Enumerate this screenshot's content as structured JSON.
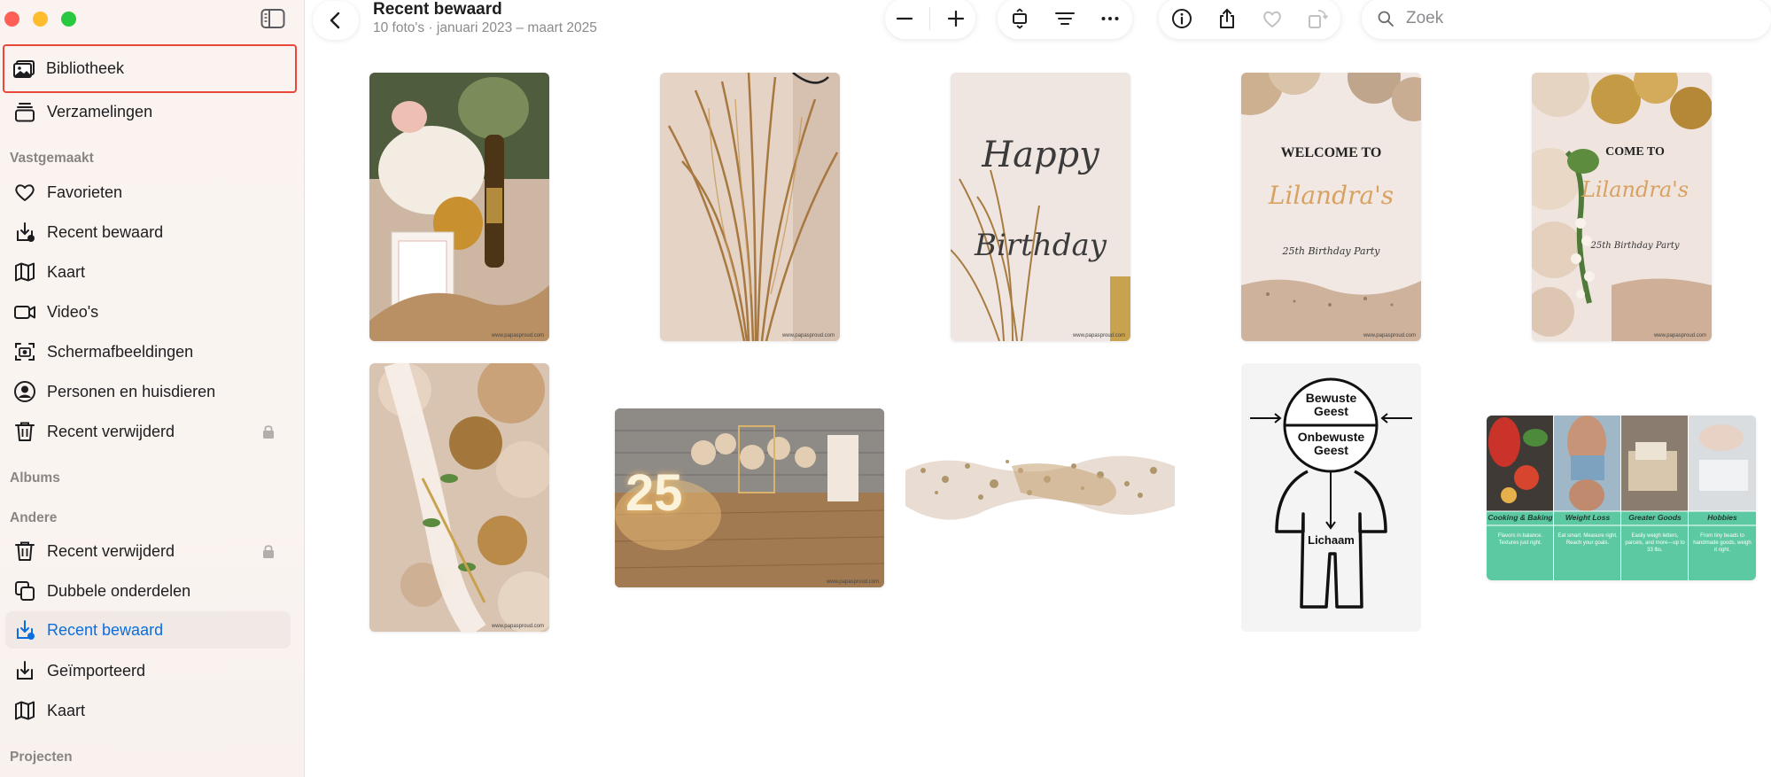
{
  "window": {
    "title": "Recent bewaard",
    "subtitle": "10 foto's · januari 2023 – maart 2025"
  },
  "sidebar": {
    "top_items": [
      {
        "label": "Bibliotheek",
        "icon": "photo-library-icon"
      },
      {
        "label": "Verzamelingen",
        "icon": "collections-icon"
      }
    ],
    "sections": {
      "pinned": "Vastgemaakt",
      "albums": "Albums",
      "other": "Andere",
      "projects": "Projecten"
    },
    "pinned_items": [
      {
        "label": "Favorieten",
        "icon": "heart-icon"
      },
      {
        "label": "Recent bewaard",
        "icon": "recently-saved-icon"
      },
      {
        "label": "Kaart",
        "icon": "map-icon"
      },
      {
        "label": "Video's",
        "icon": "video-icon"
      },
      {
        "label": "Schermafbeeldingen",
        "icon": "screenshot-icon"
      },
      {
        "label": "Personen en huisdieren",
        "icon": "person-icon"
      },
      {
        "label": "Recent verwijderd",
        "icon": "trash-icon",
        "locked": true
      }
    ],
    "other_items": [
      {
        "label": "Recent verwijderd",
        "icon": "trash-icon",
        "locked": true
      },
      {
        "label": "Dubbele onderdelen",
        "icon": "duplicates-icon"
      },
      {
        "label": "Recent bewaard",
        "icon": "recently-saved-icon",
        "selected": true
      },
      {
        "label": "Geïmporteerd",
        "icon": "import-icon"
      },
      {
        "label": "Kaart",
        "icon": "map-icon"
      }
    ]
  },
  "toolbar": {
    "search_placeholder": "Zoek",
    "buttons": [
      "back-icon",
      "zoom-out-icon",
      "zoom-in-icon",
      "aspect-icon",
      "filter-icon",
      "more-icon",
      "info-icon",
      "share-icon",
      "favorite-icon",
      "rotate-icon"
    ]
  },
  "photos": [
    {
      "id": "bottle-flowers",
      "watermark": "www.papasproud.com"
    },
    {
      "id": "pampas-grass",
      "watermark": "www.papasproud.com"
    },
    {
      "id": "happy-birthday-sign",
      "text_lines": [
        "Happy",
        "Birthday"
      ],
      "watermark": "www.papasproud.com"
    },
    {
      "id": "welcome-sign",
      "text_lines": [
        "WELCOME TO",
        "Lilandra's",
        "25th Birthday Party"
      ],
      "watermark": "www.papasproud.com"
    },
    {
      "id": "welcome-sign-balloons",
      "text_lines": [
        "COME TO",
        "Lilandra's",
        "25th Birthday Party"
      ],
      "watermark": "www.papasproud.com"
    },
    {
      "id": "balloons-flowers",
      "watermark": "www.papasproud.com"
    },
    {
      "id": "party-room-25",
      "text_lines": [
        "25"
      ],
      "watermark": "www.papasproud.com"
    },
    {
      "id": "gold-leaf-wave"
    },
    {
      "id": "mind-diagram",
      "text_lines": [
        "Bewuste",
        "Geest",
        "Onbewuste",
        "Geest",
        "Lichaam"
      ]
    },
    {
      "id": "categories-banner",
      "categories": [
        {
          "title": "Cooking & Baking",
          "desc": "Flavors in balance. Textures just right."
        },
        {
          "title": "Weight Loss",
          "desc": "Eat smart. Measure right. Reach your goals."
        },
        {
          "title": "Greater Goods",
          "desc": "Easily weigh letters, parcels, and more—up to 33 lbs."
        },
        {
          "title": "Hobbies",
          "desc": "From tiny beads to handmade goods, weigh it right."
        }
      ]
    }
  ],
  "colors": {
    "accent": "#0a6ee0",
    "highlight_outline": "#e8473a",
    "banner_green": "#5cc9a3"
  }
}
